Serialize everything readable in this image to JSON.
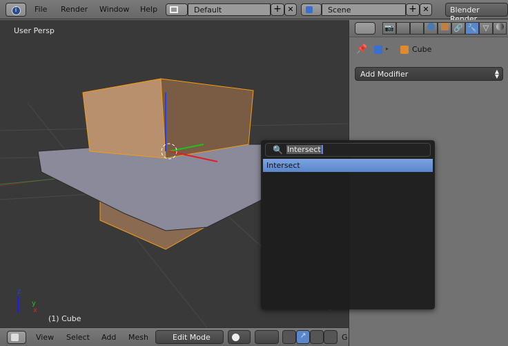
{
  "topbar": {
    "menus": [
      "File",
      "Render",
      "Window",
      "Help"
    ],
    "layout": "Default",
    "scene": "Scene",
    "engine": "Blender Render"
  },
  "viewport": {
    "view_label": "User Persp",
    "object_label": "(1) Cube",
    "axes": {
      "x": "x",
      "y": "y",
      "z": "z"
    }
  },
  "bottombar": {
    "menus": [
      "View",
      "Select",
      "Add",
      "Mesh"
    ],
    "mode": "Edit Mode",
    "truncated": "G"
  },
  "properties": {
    "object_name": "Cube",
    "add_modifier_label": "Add Modifier",
    "active_tab": "modifiers"
  },
  "popup": {
    "search_value": "Intersect",
    "results": [
      "Intersect"
    ]
  },
  "colors": {
    "selection_blue": "#5a86cc",
    "orange": "#f39c12",
    "viewport_bg": "#393939"
  }
}
